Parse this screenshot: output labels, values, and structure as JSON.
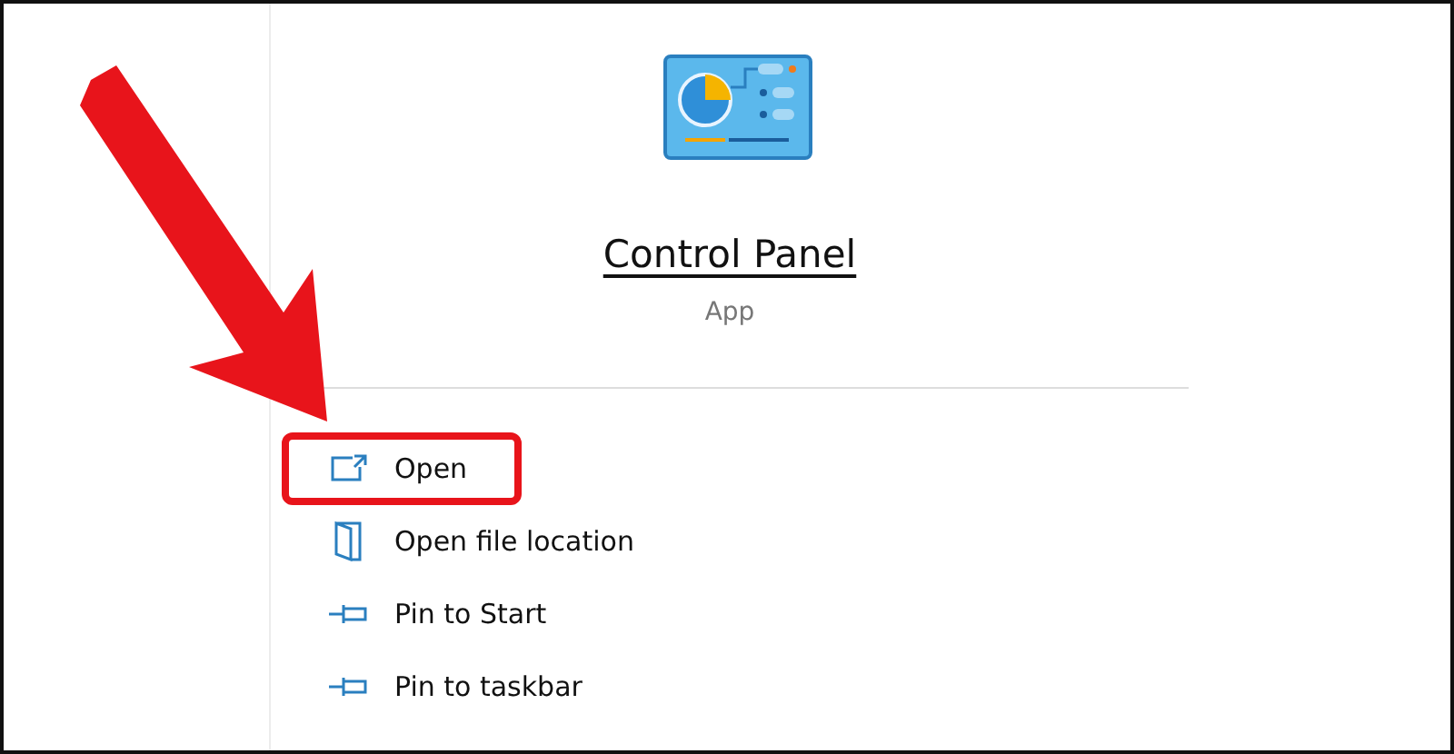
{
  "app": {
    "name": "Control Panel",
    "type": "App"
  },
  "actions": [
    {
      "label": "Open",
      "kind": "open",
      "highlighted": true
    },
    {
      "label": "Open file location",
      "kind": "location",
      "highlighted": false
    },
    {
      "label": "Pin to Start",
      "kind": "pin",
      "highlighted": false
    },
    {
      "label": "Pin to taskbar",
      "kind": "pin",
      "highlighted": false
    }
  ]
}
